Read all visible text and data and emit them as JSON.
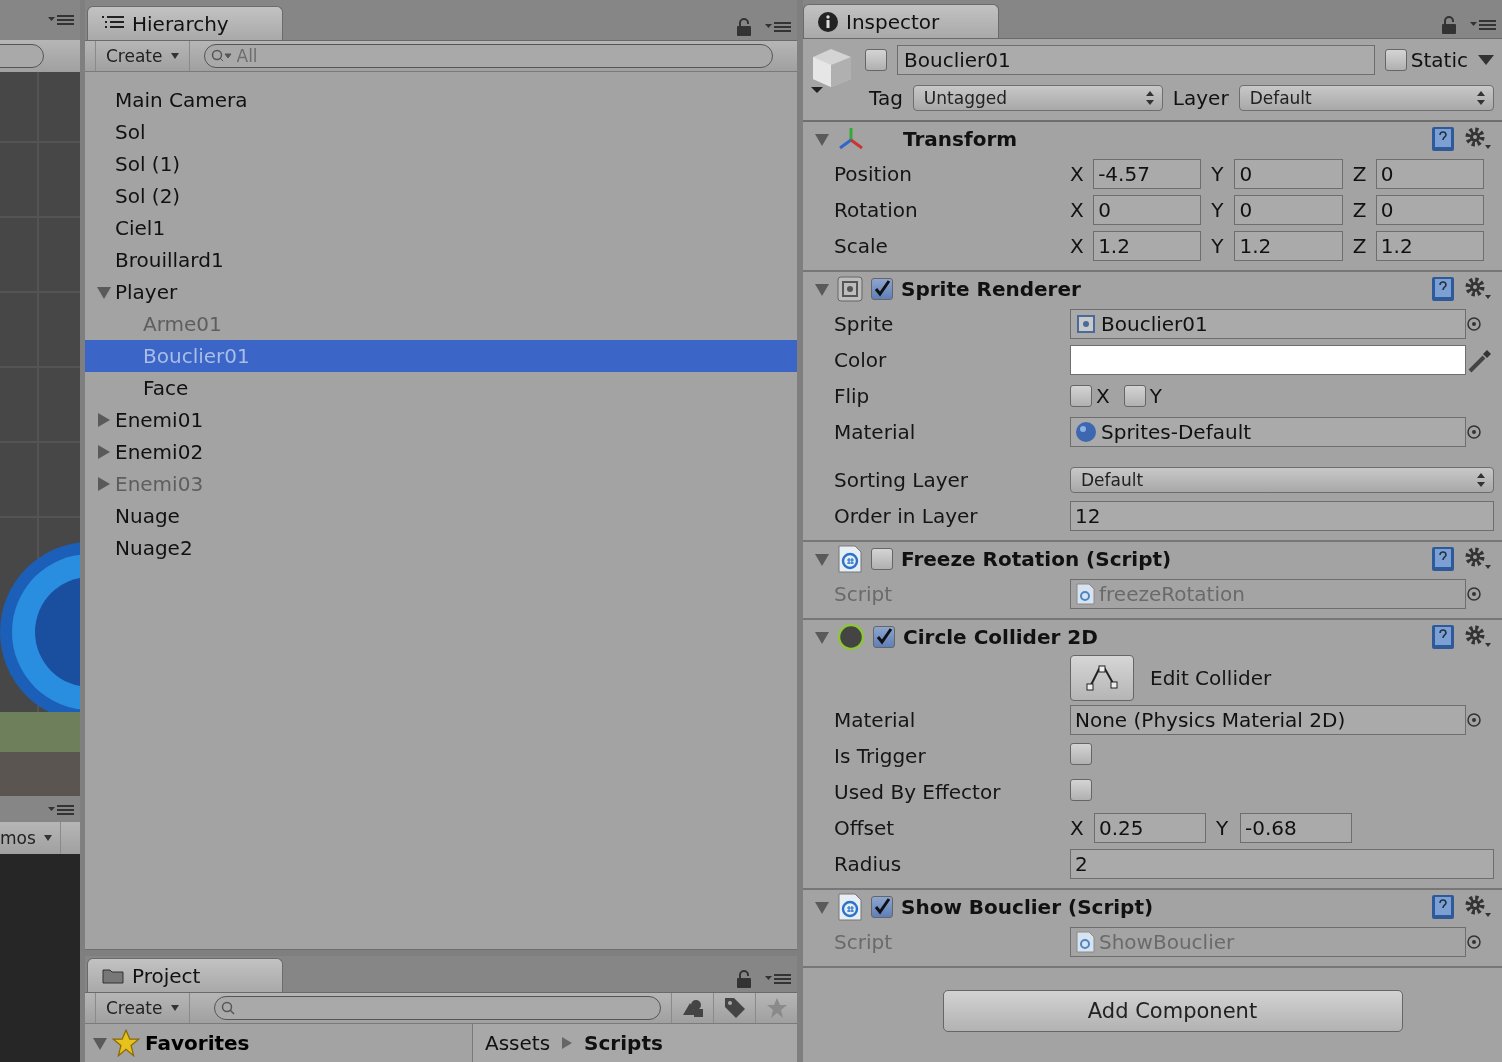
{
  "scene_panel": {
    "gizmos_button": "mos"
  },
  "hierarchy": {
    "tab": "Hierarchy",
    "create_button": "Create",
    "search": {
      "placeholder": "All"
    },
    "items": [
      {
        "label": "Main Camera",
        "selected": false,
        "disabled": false
      },
      {
        "label": "Sol",
        "selected": false,
        "disabled": false
      },
      {
        "label": "Sol (1)",
        "selected": false,
        "disabled": false
      },
      {
        "label": "Sol (2)",
        "selected": false,
        "disabled": false
      },
      {
        "label": "Ciel1",
        "selected": false,
        "disabled": false
      },
      {
        "label": "Brouillard1",
        "selected": false,
        "disabled": false
      },
      {
        "label": "Player",
        "selected": false,
        "disabled": false,
        "expanded": true,
        "children": [
          {
            "label": "Arme01",
            "selected": false,
            "disabled": true
          },
          {
            "label": "Bouclier01",
            "selected": true,
            "disabled": true
          },
          {
            "label": "Face",
            "selected": false,
            "disabled": false
          }
        ]
      },
      {
        "label": "Enemi01",
        "selected": false,
        "disabled": false,
        "expanded": false
      },
      {
        "label": "Enemi02",
        "selected": false,
        "disabled": false,
        "expanded": false
      },
      {
        "label": "Enemi03",
        "selected": false,
        "disabled": true,
        "expanded": false
      },
      {
        "label": "Nuage",
        "selected": false,
        "disabled": false
      },
      {
        "label": "Nuage2",
        "selected": false,
        "disabled": false
      }
    ]
  },
  "project": {
    "tab": "Project",
    "create_button": "Create",
    "favorites": {
      "label": "Favorites",
      "expanded": true
    },
    "breadcrumb": [
      "Assets",
      "Scripts"
    ]
  },
  "inspector": {
    "tab": "Inspector",
    "active": false,
    "name": "Bouclier01",
    "static": {
      "label": "Static",
      "checked": false
    },
    "tag": {
      "label": "Tag",
      "value": "Untagged"
    },
    "layer": {
      "label": "Layer",
      "value": "Default"
    },
    "components": [
      {
        "title": "Transform",
        "kind": "transform",
        "expanded": true,
        "rows": [
          {
            "kind": "vector",
            "label": "Position",
            "axes": [
              {
                "axis": "X",
                "value": "-4.57"
              },
              {
                "axis": "Y",
                "value": "0"
              },
              {
                "axis": "Z",
                "value": "0"
              }
            ]
          },
          {
            "kind": "vector",
            "label": "Rotation",
            "axes": [
              {
                "axis": "X",
                "value": "0"
              },
              {
                "axis": "Y",
                "value": "0"
              },
              {
                "axis": "Z",
                "value": "0"
              }
            ]
          },
          {
            "kind": "vector",
            "label": "Scale",
            "axes": [
              {
                "axis": "X",
                "value": "1.2"
              },
              {
                "axis": "Y",
                "value": "1.2"
              },
              {
                "axis": "Z",
                "value": "1.2"
              }
            ]
          }
        ]
      },
      {
        "title": "Sprite Renderer",
        "kind": "sprite",
        "enabled": true,
        "expanded": true,
        "rows": [
          {
            "kind": "sprite_ref",
            "label": "Sprite",
            "value": "Bouclier01",
            "disabled": false
          },
          {
            "kind": "color",
            "label": "Color",
            "color": "#ffffff"
          },
          {
            "kind": "toggles",
            "label": "Flip",
            "options": [
              {
                "label": "X",
                "checked": false
              },
              {
                "label": "Y",
                "checked": false
              }
            ]
          },
          {
            "kind": "material_ref",
            "label": "Material",
            "value": "Sprites-Default",
            "disabled": false
          },
          {
            "kind": "dropdown",
            "label": "Sorting Layer",
            "value": "Default"
          },
          {
            "kind": "text",
            "label": "Order in Layer",
            "value": "12"
          }
        ]
      },
      {
        "title": "Freeze Rotation (Script)",
        "kind": "script",
        "enabled": false,
        "expanded": true,
        "rows": [
          {
            "kind": "script_ref",
            "label": "Script",
            "value": "freezeRotation",
            "disabled": true
          }
        ]
      },
      {
        "title": "Circle Collider 2D",
        "kind": "collider",
        "enabled": true,
        "expanded": true,
        "rows": [
          {
            "kind": "button",
            "label": "Edit Collider"
          },
          {
            "kind": "object",
            "label": "Material",
            "value": "None (Physics Material 2D)",
            "disabled": false
          },
          {
            "kind": "checkbox",
            "label": "Is Trigger",
            "checked": false
          },
          {
            "kind": "checkbox",
            "label": "Used By Effector",
            "checked": false
          },
          {
            "kind": "vector",
            "label": "Offset",
            "axes": [
              {
                "axis": "X",
                "value": "0.25"
              },
              {
                "axis": "Y",
                "value": "-0.68"
              }
            ]
          },
          {
            "kind": "text",
            "label": "Radius",
            "value": "2"
          }
        ]
      },
      {
        "title": "Show Bouclier (Script)",
        "kind": "script",
        "enabled": true,
        "expanded": true,
        "rows": [
          {
            "kind": "script_ref",
            "label": "Script",
            "value": "ShowBouclier",
            "disabled": true
          }
        ]
      }
    ],
    "add_button": "Add Component"
  }
}
